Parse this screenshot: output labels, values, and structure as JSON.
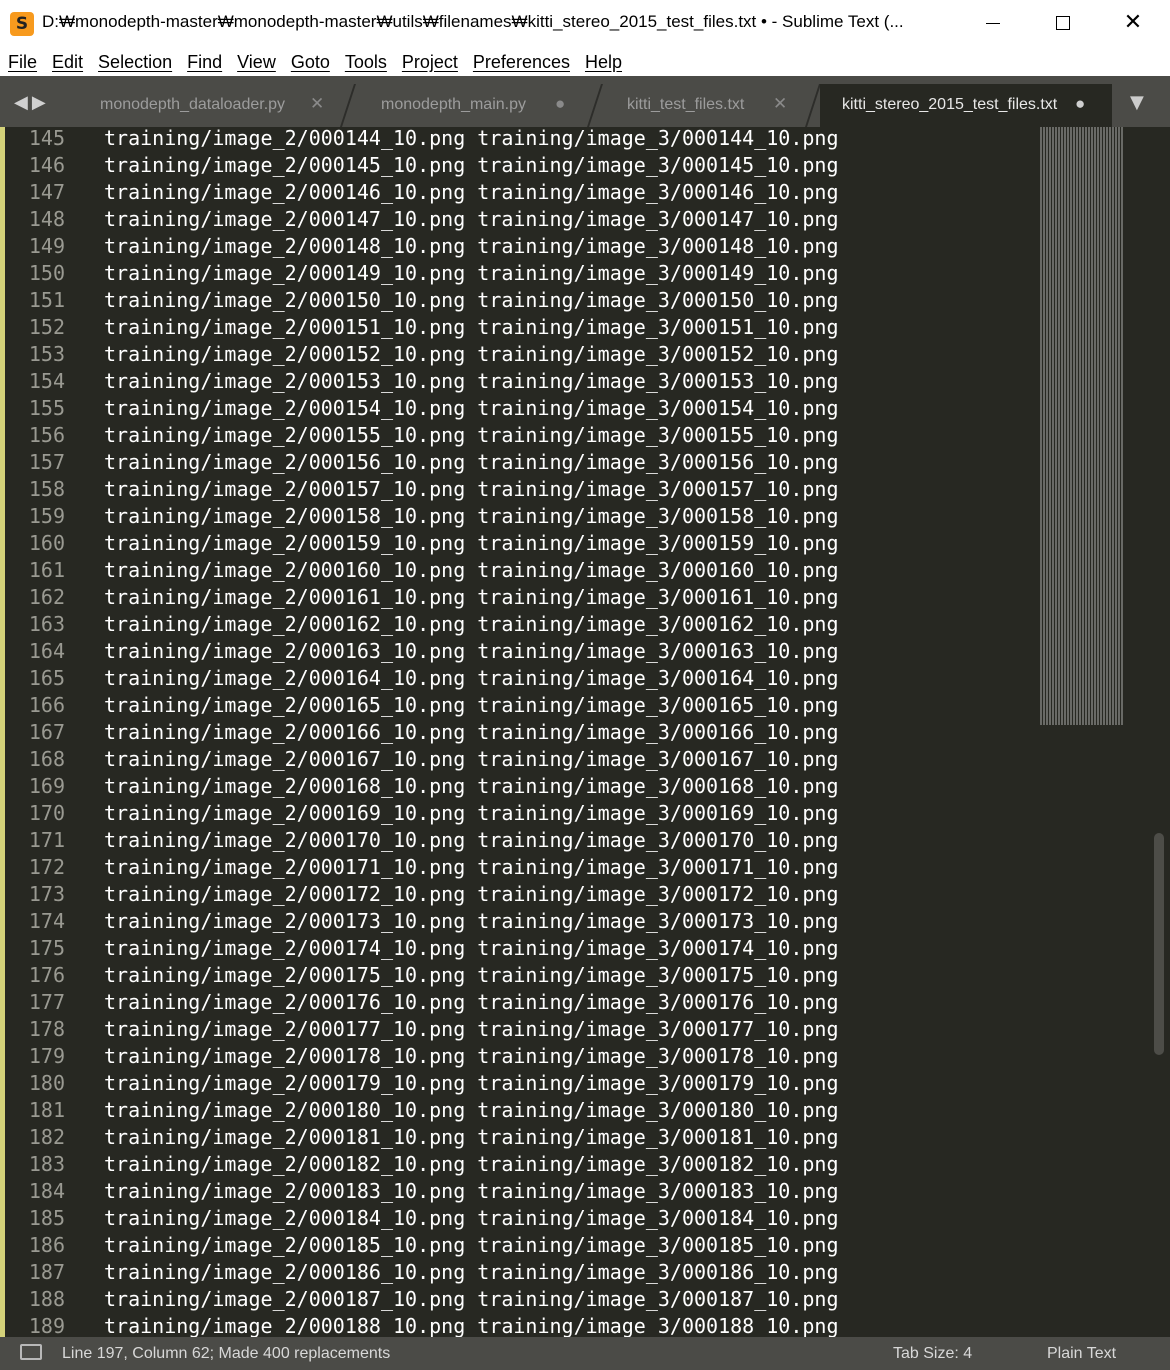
{
  "window": {
    "title": "D:₩monodepth-master₩monodepth-master₩utils₩filenames₩kitti_stereo_2015_test_files.txt • - Sublime Text (...",
    "app_icon": "sublime-text-icon",
    "minimize_icon": "minimize-icon",
    "maximize_icon": "maximize-icon",
    "close_icon": "close-icon"
  },
  "menu": [
    "File",
    "Edit",
    "Selection",
    "Find",
    "View",
    "Goto",
    "Tools",
    "Project",
    "Preferences",
    "Help"
  ],
  "tabs": [
    {
      "label": "monodepth_dataloader.py",
      "state": "close"
    },
    {
      "label": "monodepth_main.py",
      "state": "modified"
    },
    {
      "label": "kitti_test_files.txt",
      "state": "close"
    },
    {
      "label": "kitti_stereo_2015_test_files.txt",
      "state": "modified",
      "active": true
    }
  ],
  "editor": {
    "first_line": 145,
    "lines": [
      "training/image_2/000144_10.png training/image_3/000144_10.png",
      "training/image_2/000145_10.png training/image_3/000145_10.png",
      "training/image_2/000146_10.png training/image_3/000146_10.png",
      "training/image_2/000147_10.png training/image_3/000147_10.png",
      "training/image_2/000148_10.png training/image_3/000148_10.png",
      "training/image_2/000149_10.png training/image_3/000149_10.png",
      "training/image_2/000150_10.png training/image_3/000150_10.png",
      "training/image_2/000151_10.png training/image_3/000151_10.png",
      "training/image_2/000152_10.png training/image_3/000152_10.png",
      "training/image_2/000153_10.png training/image_3/000153_10.png",
      "training/image_2/000154_10.png training/image_3/000154_10.png",
      "training/image_2/000155_10.png training/image_3/000155_10.png",
      "training/image_2/000156_10.png training/image_3/000156_10.png",
      "training/image_2/000157_10.png training/image_3/000157_10.png",
      "training/image_2/000158_10.png training/image_3/000158_10.png",
      "training/image_2/000159_10.png training/image_3/000159_10.png",
      "training/image_2/000160_10.png training/image_3/000160_10.png",
      "training/image_2/000161_10.png training/image_3/000161_10.png",
      "training/image_2/000162_10.png training/image_3/000162_10.png",
      "training/image_2/000163_10.png training/image_3/000163_10.png",
      "training/image_2/000164_10.png training/image_3/000164_10.png",
      "training/image_2/000165_10.png training/image_3/000165_10.png",
      "training/image_2/000166_10.png training/image_3/000166_10.png",
      "training/image_2/000167_10.png training/image_3/000167_10.png",
      "training/image_2/000168_10.png training/image_3/000168_10.png",
      "training/image_2/000169_10.png training/image_3/000169_10.png",
      "training/image_2/000170_10.png training/image_3/000170_10.png",
      "training/image_2/000171_10.png training/image_3/000171_10.png",
      "training/image_2/000172_10.png training/image_3/000172_10.png",
      "training/image_2/000173_10.png training/image_3/000173_10.png",
      "training/image_2/000174_10.png training/image_3/000174_10.png",
      "training/image_2/000175_10.png training/image_3/000175_10.png",
      "training/image_2/000176_10.png training/image_3/000176_10.png",
      "training/image_2/000177_10.png training/image_3/000177_10.png",
      "training/image_2/000178_10.png training/image_3/000178_10.png",
      "training/image_2/000179_10.png training/image_3/000179_10.png",
      "training/image_2/000180_10.png training/image_3/000180_10.png",
      "training/image_2/000181_10.png training/image_3/000181_10.png",
      "training/image_2/000182_10.png training/image_3/000182_10.png",
      "training/image_2/000183_10.png training/image_3/000183_10.png",
      "training/image_2/000184_10.png training/image_3/000184_10.png",
      "training/image_2/000185_10.png training/image_3/000185_10.png",
      "training/image_2/000186_10.png training/image_3/000186_10.png",
      "training/image_2/000187_10.png training/image_3/000187_10.png",
      "training/image_2/000188_10.png training/image_3/000188_10.png"
    ]
  },
  "status": {
    "text": "Line 197, Column 62; Made 400 replacements",
    "tab_size": "Tab Size: 4",
    "syntax": "Plain Text"
  },
  "colors": {
    "editor_bg": "#272822",
    "chrome_bg": "#4b4b47",
    "modified_marker": "#d4d27a",
    "app_icon": "#f79a1e"
  }
}
